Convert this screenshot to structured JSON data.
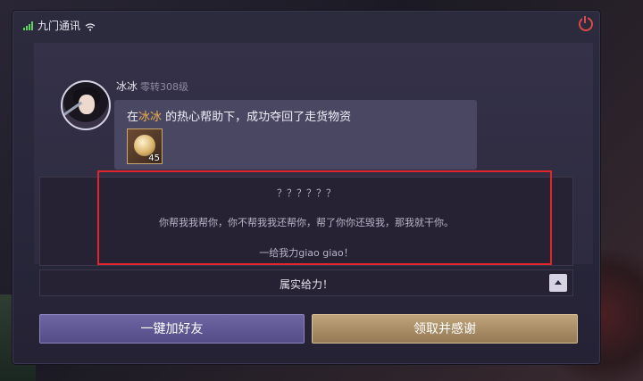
{
  "status_bar": {
    "carrier": "九门通讯"
  },
  "sender": {
    "name": "冰冰",
    "level": "零转308级"
  },
  "message": {
    "prefix": "在",
    "highlight": "冰冰",
    "suffix": " 的热心帮助下，成功夺回了走货物资",
    "item_quantity": "45"
  },
  "reply": {
    "line1": "？？？？？？",
    "line2": "你帮我我帮你，你不帮我我还帮你，帮了你你还毁我，那我就干你。",
    "line3": "一给我力giao giao！"
  },
  "tagline": {
    "text": "属实给力！"
  },
  "buttons": {
    "add_friend": "一键加好友",
    "claim_thanks": "领取并感谢"
  },
  "colors": {
    "highlight": "#f0b04a",
    "annotation_frame": "#e1252d",
    "signal": "#5cd35c",
    "power": "#d94a4a"
  }
}
